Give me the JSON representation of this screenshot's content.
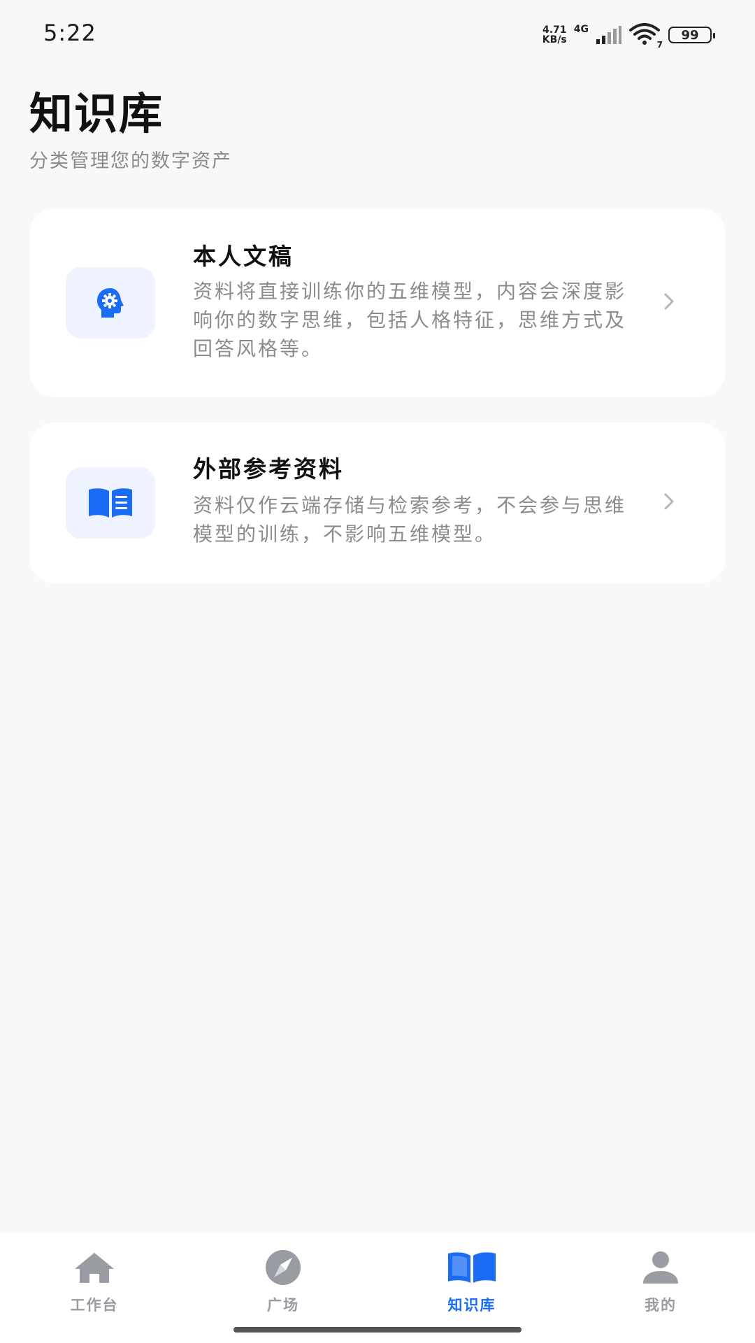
{
  "status_bar": {
    "time": "5:22",
    "net_speed_value": "4.71",
    "net_speed_unit": "KB/s",
    "network_type": "4G",
    "wifi_badge": "7",
    "battery": "99"
  },
  "page": {
    "title": "知识库",
    "subtitle": "分类管理您的数字资产"
  },
  "cards": [
    {
      "title": "本人文稿",
      "description": "资料将直接训练你的五维模型，内容会深度影响你的数字思维，包括人格特征，思维方式及回答风格等。",
      "icon": "head-gear-icon"
    },
    {
      "title": "外部参考资料",
      "description": "资料仅作云端存储与检索参考，不会参与思维模型的训练，不影响五维模型。",
      "icon": "open-book-icon"
    }
  ],
  "tabs": [
    {
      "label": "工作台",
      "icon": "home-icon",
      "active": false
    },
    {
      "label": "广场",
      "icon": "compass-icon",
      "active": false
    },
    {
      "label": "知识库",
      "icon": "book-icon",
      "active": true
    },
    {
      "label": "我的",
      "icon": "user-icon",
      "active": false
    }
  ],
  "colors": {
    "accent": "#1a6cf5",
    "background": "#f8f8f9",
    "card": "#ffffff",
    "icon_box": "#eef3ff",
    "tab_inactive": "#9a9ca3",
    "muted_text": "#8b8b90"
  }
}
